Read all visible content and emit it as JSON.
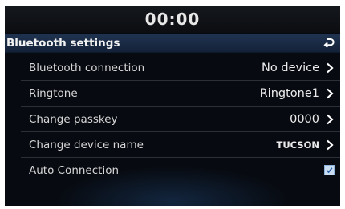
{
  "status_bar": {
    "time": "00:00"
  },
  "header": {
    "title": "Bluetooth settings",
    "back_icon": "return-arrow-icon"
  },
  "settings": [
    {
      "label": "Bluetooth connection",
      "value": "No device",
      "control": "chevron-right-icon"
    },
    {
      "label": "Ringtone",
      "value": "Ringtone1",
      "control": "chevron-right-icon"
    },
    {
      "label": "Change passkey",
      "value": "0000",
      "control": "chevron-right-icon"
    },
    {
      "label": "Change device name",
      "value": "TUCSON",
      "control": "chevron-right-icon"
    },
    {
      "label": "Auto Connection",
      "checked": true,
      "control": "checkbox"
    }
  ],
  "colors": {
    "screen_bg": "#070a10",
    "title_bar": "#1f3350",
    "checkbox_fill": "#c9def3",
    "check_mark": "#2a5fa8"
  }
}
